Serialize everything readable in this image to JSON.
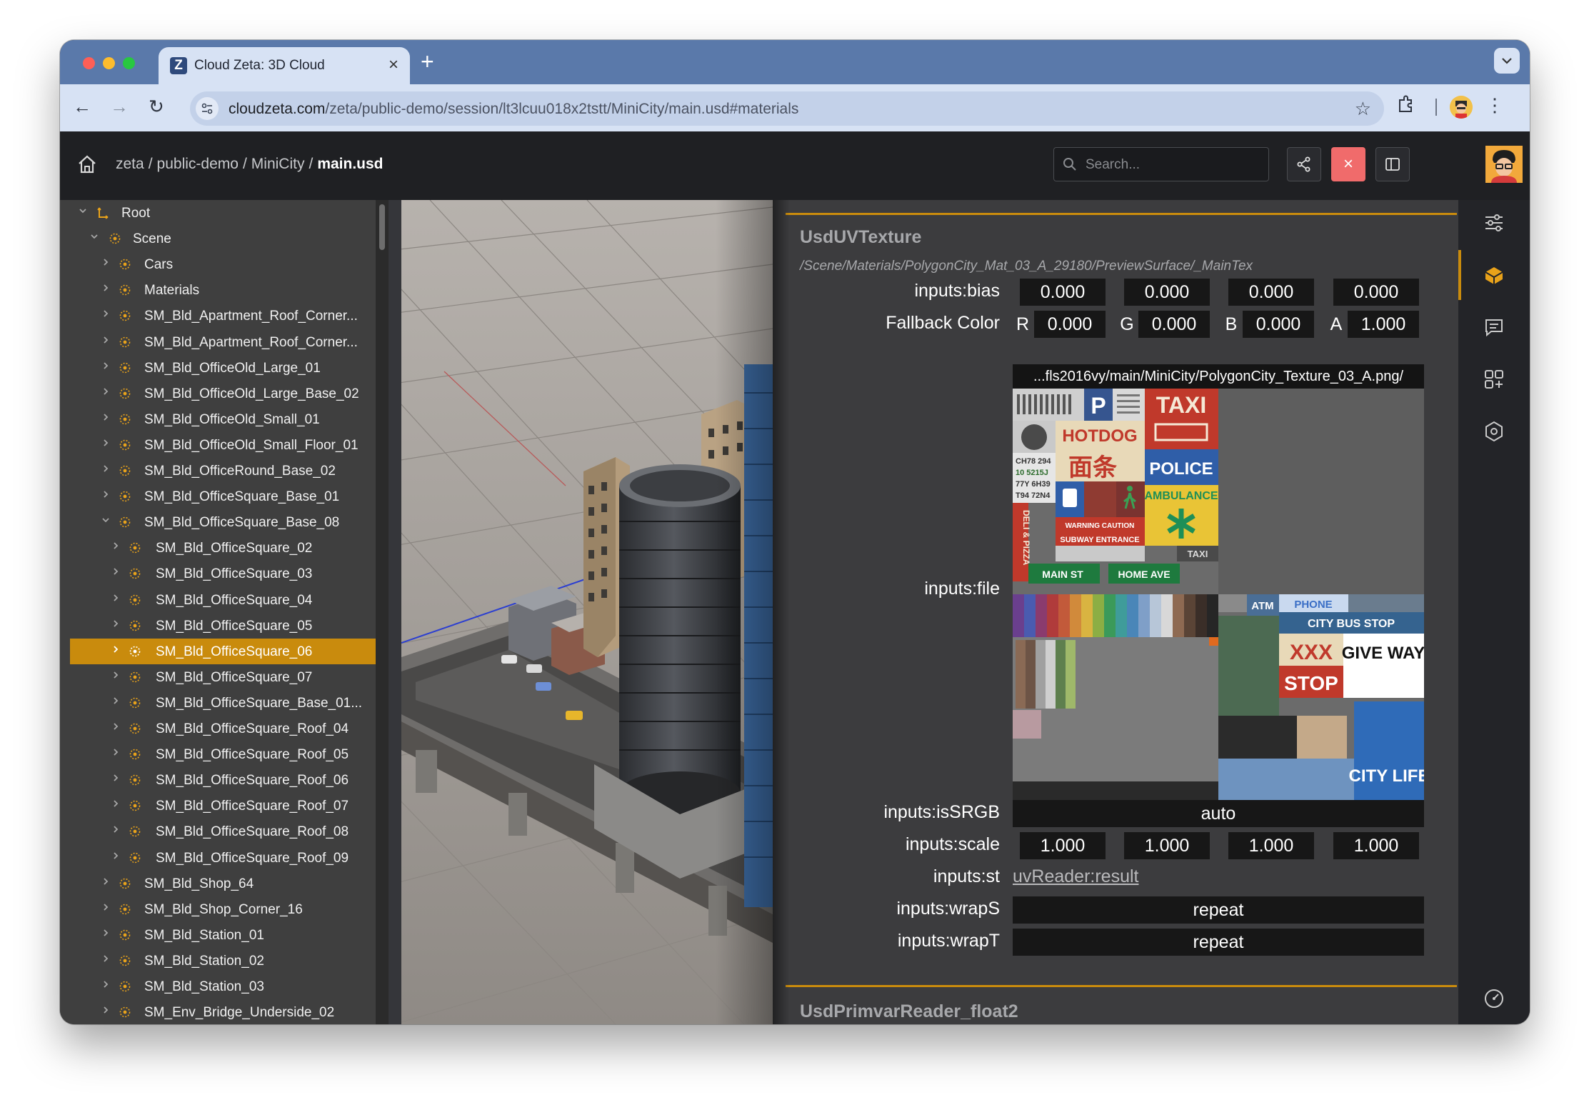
{
  "browser": {
    "tab_title": "Cloud Zeta: 3D Cloud",
    "tab_favicon": "Z",
    "tab_close": "×",
    "new_tab": "+",
    "url_domain": "cloudzeta.com",
    "url_rest": "/zeta/public-demo/session/lt3lcuu018x2tstt/MiniCity/main.usd#materials"
  },
  "app": {
    "breadcrumb": [
      "zeta",
      "public-demo",
      "MiniCity"
    ],
    "breadcrumb_current": "main.usd",
    "search_placeholder": "Search...",
    "close_label": "×"
  },
  "tree": {
    "rows": [
      {
        "label": "Root",
        "level": 0,
        "expanded": true
      },
      {
        "label": "Scene",
        "level": 1,
        "expanded": true
      },
      {
        "label": "Cars",
        "level": 2,
        "expanded": false
      },
      {
        "label": "Materials",
        "level": 2,
        "expanded": false
      },
      {
        "label": "SM_Bld_Apartment_Roof_Corner...",
        "level": 2,
        "expanded": false
      },
      {
        "label": "SM_Bld_Apartment_Roof_Corner...",
        "level": 2,
        "expanded": false
      },
      {
        "label": "SM_Bld_OfficeOld_Large_01",
        "level": 2,
        "expanded": false
      },
      {
        "label": "SM_Bld_OfficeOld_Large_Base_02",
        "level": 2,
        "expanded": false
      },
      {
        "label": "SM_Bld_OfficeOld_Small_01",
        "level": 2,
        "expanded": false
      },
      {
        "label": "SM_Bld_OfficeOld_Small_Floor_01",
        "level": 2,
        "expanded": false
      },
      {
        "label": "SM_Bld_OfficeRound_Base_02",
        "level": 2,
        "expanded": false
      },
      {
        "label": "SM_Bld_OfficeSquare_Base_01",
        "level": 2,
        "expanded": false
      },
      {
        "label": "SM_Bld_OfficeSquare_Base_08",
        "level": 2,
        "expanded": true
      },
      {
        "label": "SM_Bld_OfficeSquare_02",
        "level": 3,
        "expanded": false
      },
      {
        "label": "SM_Bld_OfficeSquare_03",
        "level": 3,
        "expanded": false
      },
      {
        "label": "SM_Bld_OfficeSquare_04",
        "level": 3,
        "expanded": false
      },
      {
        "label": "SM_Bld_OfficeSquare_05",
        "level": 3,
        "expanded": false
      },
      {
        "label": "SM_Bld_OfficeSquare_06",
        "level": 3,
        "expanded": false,
        "selected": true
      },
      {
        "label": "SM_Bld_OfficeSquare_07",
        "level": 3,
        "expanded": false
      },
      {
        "label": "SM_Bld_OfficeSquare_Base_01...",
        "level": 3,
        "expanded": false
      },
      {
        "label": "SM_Bld_OfficeSquare_Roof_04",
        "level": 3,
        "expanded": false
      },
      {
        "label": "SM_Bld_OfficeSquare_Roof_05",
        "level": 3,
        "expanded": false
      },
      {
        "label": "SM_Bld_OfficeSquare_Roof_06",
        "level": 3,
        "expanded": false
      },
      {
        "label": "SM_Bld_OfficeSquare_Roof_07",
        "level": 3,
        "expanded": false
      },
      {
        "label": "SM_Bld_OfficeSquare_Roof_08",
        "level": 3,
        "expanded": false
      },
      {
        "label": "SM_Bld_OfficeSquare_Roof_09",
        "level": 3,
        "expanded": false
      },
      {
        "label": "SM_Bld_Shop_64",
        "level": 2,
        "expanded": false
      },
      {
        "label": "SM_Bld_Shop_Corner_16",
        "level": 2,
        "expanded": false
      },
      {
        "label": "SM_Bld_Station_01",
        "level": 2,
        "expanded": false
      },
      {
        "label": "SM_Bld_Station_02",
        "level": 2,
        "expanded": false
      },
      {
        "label": "SM_Bld_Station_03",
        "level": 2,
        "expanded": false
      },
      {
        "label": "SM_Env_Bridge_Underside_02",
        "level": 2,
        "expanded": false
      }
    ]
  },
  "props": {
    "section_title": "UsdUVTexture",
    "section_path": "/Scene/Materials/PolygonCity_Mat_03_A_29180/PreviewSurface/_MainTex",
    "bias_label": "inputs:bias",
    "bias": [
      "0.000",
      "0.000",
      "0.000",
      "0.000"
    ],
    "fallback_label": "Fallback Color",
    "fallback_channels": [
      "R",
      "G",
      "B",
      "A"
    ],
    "fallback": [
      "0.000",
      "0.000",
      "0.000",
      "1.000"
    ],
    "file_label": "inputs:file",
    "file_path": "...fls2016vy/main/MiniCity/PolygonCity_Texture_03_A.png/",
    "issrgb_label": "inputs:isSRGB",
    "issrgb": "auto",
    "scale_label": "inputs:scale",
    "scale": [
      "1.000",
      "1.000",
      "1.000",
      "1.000"
    ],
    "st_label": "inputs:st",
    "st_value": "uvReader:result",
    "wraps_label": "inputs:wrapS",
    "wraps": "repeat",
    "wrapt_label": "inputs:wrapT",
    "wrapt": "repeat",
    "next_section_title": "UsdPrimvarReader_float2"
  },
  "texture_text": {
    "p": "P",
    "taxi": "TAXI",
    "hotdog": "HOTDOG",
    "noodle": "面条",
    "police": "POLICE",
    "plate1": "CH78 294",
    "plate2": "10 5215J",
    "plate3": "77Y 6H39",
    "plate4": "T94 72N4",
    "ambulance": "AMBULANCE",
    "warning": "WARNING CAUTION",
    "subway": "SUBWAY ENTRANCE",
    "taxi_small": "TAXI",
    "pizza": "DELI & PIZZA",
    "main_st": "MAIN ST",
    "home_ave": "HOME AVE",
    "atm": "ATM",
    "phone": "PHONE",
    "bus_stop": "CITY BUS STOP",
    "xxx": "XXX",
    "give_way": "GIVE WAY",
    "stop": "STOP",
    "city_life": "CITY LIFE"
  },
  "colors": {
    "accent": "#c98b0d",
    "tab_strip": "#5a79aa",
    "toolbar": "#d7e2f4",
    "close_button": "#f06b6b"
  }
}
